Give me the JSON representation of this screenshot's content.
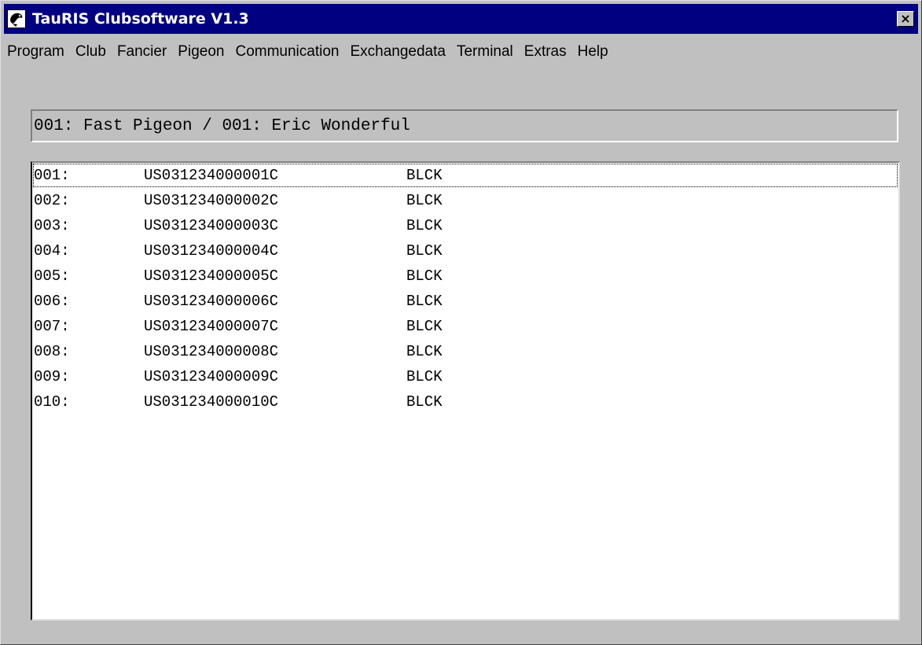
{
  "window": {
    "title": "TauRIS Clubsoftware  V1.3",
    "close_symbol": "×"
  },
  "menu": [
    "Program",
    "Club",
    "Fancier",
    "Pigeon",
    "Communication",
    "Exchangedata",
    "Terminal",
    "Extras",
    "Help"
  ],
  "header": {
    "text": "001: Fast Pigeon / 001: Eric Wonderful"
  },
  "pigeons": [
    {
      "num": "001:",
      "ring": "US031234000001C",
      "color": "BLCK"
    },
    {
      "num": "002:",
      "ring": "US031234000002C",
      "color": "BLCK"
    },
    {
      "num": "003:",
      "ring": "US031234000003C",
      "color": "BLCK"
    },
    {
      "num": "004:",
      "ring": "US031234000004C",
      "color": "BLCK"
    },
    {
      "num": "005:",
      "ring": "US031234000005C",
      "color": "BLCK"
    },
    {
      "num": "006:",
      "ring": "US031234000006C",
      "color": "BLCK"
    },
    {
      "num": "007:",
      "ring": "US031234000007C",
      "color": "BLCK"
    },
    {
      "num": "008:",
      "ring": "US031234000008C",
      "color": "BLCK"
    },
    {
      "num": "009:",
      "ring": "US031234000009C",
      "color": "BLCK"
    },
    {
      "num": "010:",
      "ring": "US031234000010C",
      "color": "BLCK"
    }
  ],
  "colors": {
    "titlebar": "#000080",
    "face": "#c0c0c0",
    "list_background": "#ffffff"
  },
  "icons": {
    "app": "pigeon-app-icon",
    "close": "close-icon"
  }
}
